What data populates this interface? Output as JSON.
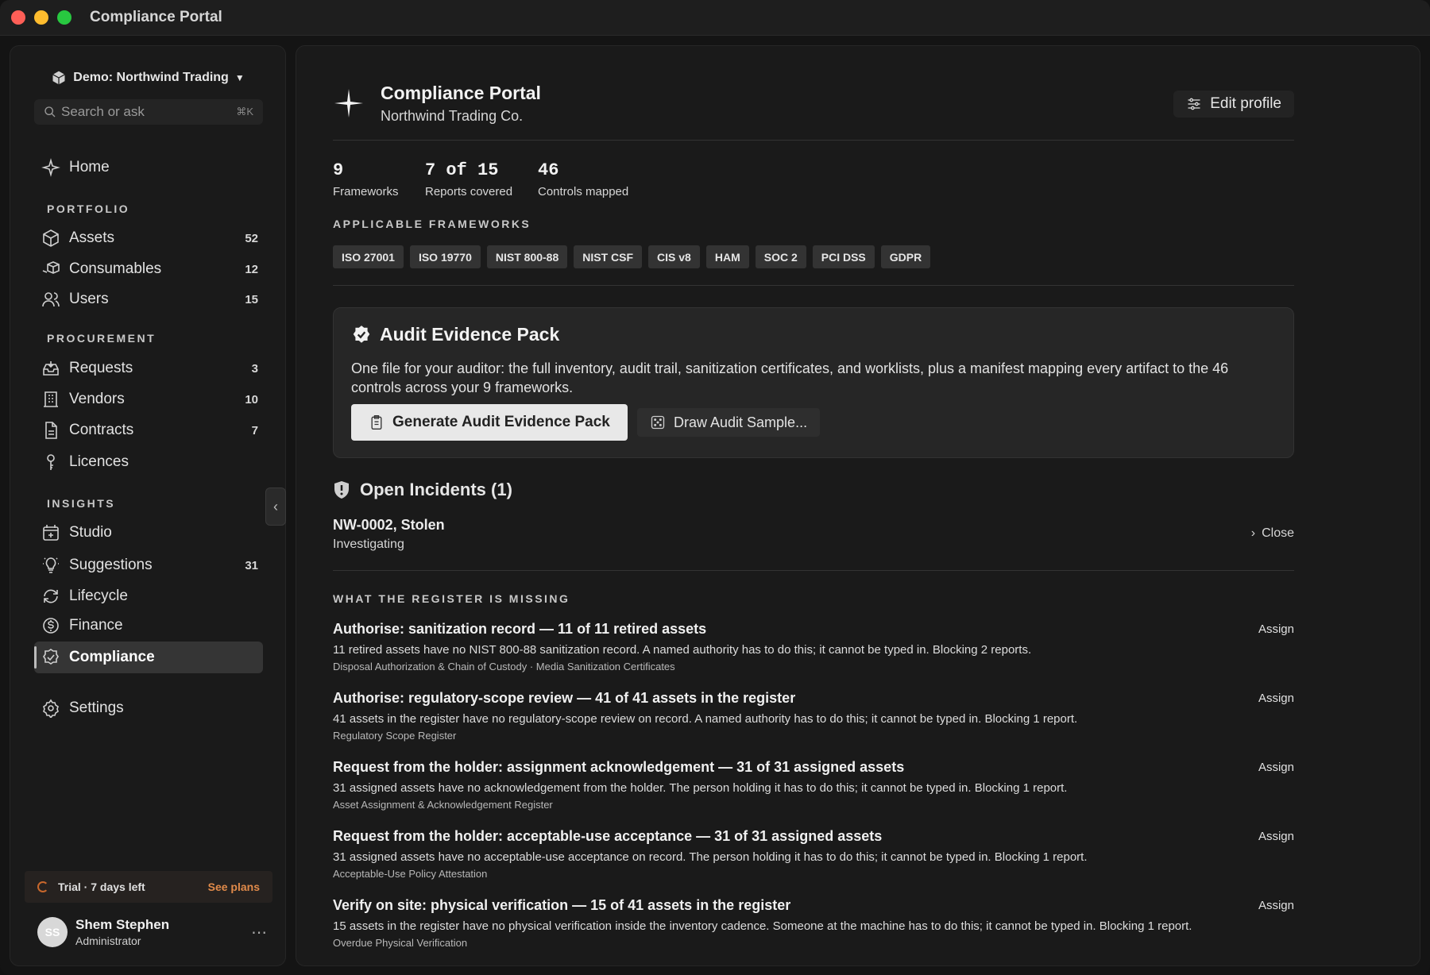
{
  "window": {
    "title": "Compliance Portal"
  },
  "sidebar": {
    "workspace": "Demo: Northwind Trading",
    "search_placeholder": "Search or ask",
    "search_shortcut": "⌘K",
    "home": "Home",
    "sections": {
      "portfolio": "PORTFOLIO",
      "procurement": "PROCUREMENT",
      "insights": "INSIGHTS"
    },
    "items": [
      {
        "label": "Assets",
        "count": "52"
      },
      {
        "label": "Consumables",
        "count": "12"
      },
      {
        "label": "Users",
        "count": "15"
      },
      {
        "label": "Requests",
        "count": "3"
      },
      {
        "label": "Vendors",
        "count": "10"
      },
      {
        "label": "Contracts",
        "count": "7"
      },
      {
        "label": "Licences",
        "count": ""
      },
      {
        "label": "Studio",
        "count": ""
      },
      {
        "label": "Suggestions",
        "count": "31"
      },
      {
        "label": "Lifecycle",
        "count": ""
      },
      {
        "label": "Finance",
        "count": ""
      },
      {
        "label": "Compliance",
        "count": ""
      }
    ],
    "settings": "Settings",
    "trial": {
      "text": "Trial · 7 days left",
      "link": "See plans"
    },
    "user": {
      "initials": "SS",
      "name": "Shem Stephen",
      "role": "Administrator"
    }
  },
  "header": {
    "title": "Compliance Portal",
    "subtitle": "Northwind Trading Co.",
    "edit_label": "Edit profile"
  },
  "stats": [
    {
      "value": "9",
      "label": "Frameworks"
    },
    {
      "value": "7 of 15",
      "label": "Reports covered"
    },
    {
      "value": "46",
      "label": "Controls mapped"
    }
  ],
  "frameworks": {
    "heading": "APPLICABLE FRAMEWORKS",
    "items": [
      "ISO 27001",
      "ISO 19770",
      "NIST 800-88",
      "NIST CSF",
      "CIS v8",
      "HAM",
      "SOC 2",
      "PCI DSS",
      "GDPR"
    ]
  },
  "evidence_card": {
    "title": "Audit Evidence Pack",
    "description": "One file for your auditor: the full inventory, audit trail, sanitization certificates, and worklists, plus a manifest mapping every artifact to the 46 controls across your 9 frameworks.",
    "primary_label": "Generate Audit Evidence Pack",
    "secondary_label": "Draw Audit Sample..."
  },
  "incidents": {
    "title": "Open Incidents (1)",
    "items": [
      {
        "name": "NW-0002, Stolen",
        "status": "Investigating",
        "action": "Close"
      }
    ]
  },
  "gaps": {
    "heading": "WHAT THE REGISTER IS MISSING",
    "assign_label": "Assign",
    "items": [
      {
        "title": "Authorise: sanitization record — 11 of 11 retired assets",
        "description": "11 retired assets have no NIST 800-88 sanitization record. A named authority has to do this; it cannot be typed in. Blocking 2 reports.",
        "source": "Disposal Authorization & Chain of Custody · Media Sanitization Certificates"
      },
      {
        "title": "Authorise: regulatory-scope review — 41 of 41 assets in the register",
        "description": "41 assets in the register have no regulatory-scope review on record. A named authority has to do this; it cannot be typed in. Blocking 1 report.",
        "source": "Regulatory Scope Register"
      },
      {
        "title": "Request from the holder: assignment acknowledgement — 31 of 31 assigned assets",
        "description": "31 assigned assets have no acknowledgement from the holder. The person holding it has to do this; it cannot be typed in. Blocking 1 report.",
        "source": "Asset Assignment & Acknowledgement Register"
      },
      {
        "title": "Request from the holder: acceptable-use acceptance — 31 of 31 assigned assets",
        "description": "31 assigned assets have no acceptable-use acceptance on record. The person holding it has to do this; it cannot be typed in. Blocking 1 report.",
        "source": "Acceptable-Use Policy Attestation"
      },
      {
        "title": "Verify on site: physical verification — 15 of 41 assets in the register",
        "description": "15 assets in the register have no physical verification inside the inventory cadence. Someone at the machine has to do this; it cannot be typed in. Blocking 1 report.",
        "source": "Overdue Physical Verification"
      }
    ]
  }
}
